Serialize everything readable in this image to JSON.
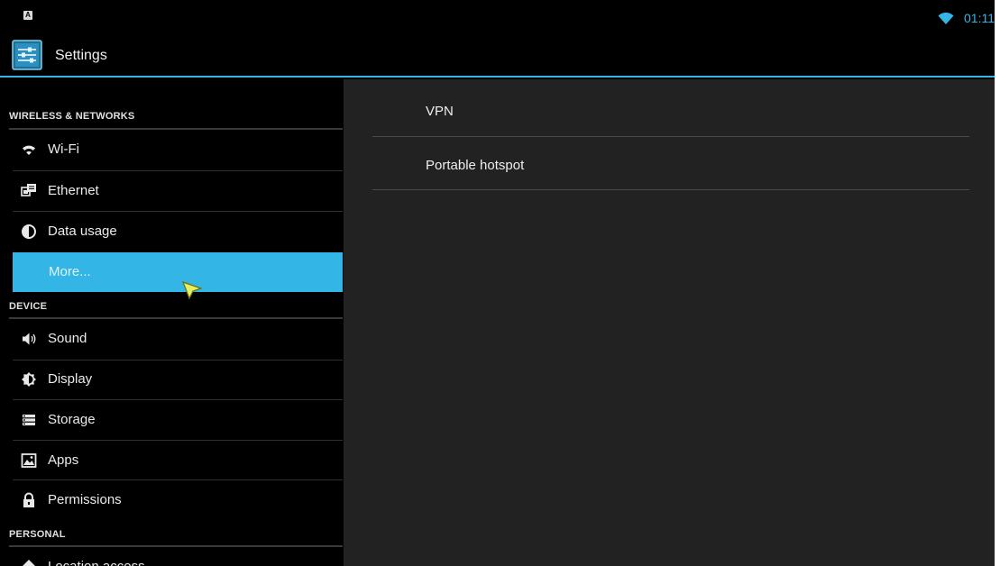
{
  "status_bar": {
    "time": "01:11",
    "notification_icon": "notification-icon",
    "wifi_icon": "wifi-icon"
  },
  "action_bar": {
    "title": "Settings",
    "app_icon": "settings-sliders-icon"
  },
  "left_pane": {
    "sections": [
      {
        "header": "WIRELESS & NETWORKS",
        "items": [
          {
            "label": "Wi-Fi",
            "icon": "wifi-icon"
          },
          {
            "label": "Ethernet",
            "icon": "ethernet-icon"
          },
          {
            "label": "Data usage",
            "icon": "data-usage-icon"
          },
          {
            "label": "More...",
            "icon": "",
            "selected": true
          }
        ]
      },
      {
        "header": "DEVICE",
        "items": [
          {
            "label": "Sound",
            "icon": "speaker-icon"
          },
          {
            "label": "Display",
            "icon": "brightness-icon"
          },
          {
            "label": "Storage",
            "icon": "storage-icon"
          },
          {
            "label": "Apps",
            "icon": "apps-icon"
          },
          {
            "label": "Permissions",
            "icon": "lock-icon"
          }
        ]
      },
      {
        "header": "PERSONAL",
        "items": [
          {
            "label": "Location access",
            "icon": "location-icon"
          }
        ]
      }
    ]
  },
  "right_pane": {
    "items": [
      {
        "label": "VPN"
      },
      {
        "label": "Portable hotspot"
      }
    ]
  },
  "colors": {
    "accent": "#33b5e5",
    "background": "#000000",
    "detail_background": "#222222"
  }
}
